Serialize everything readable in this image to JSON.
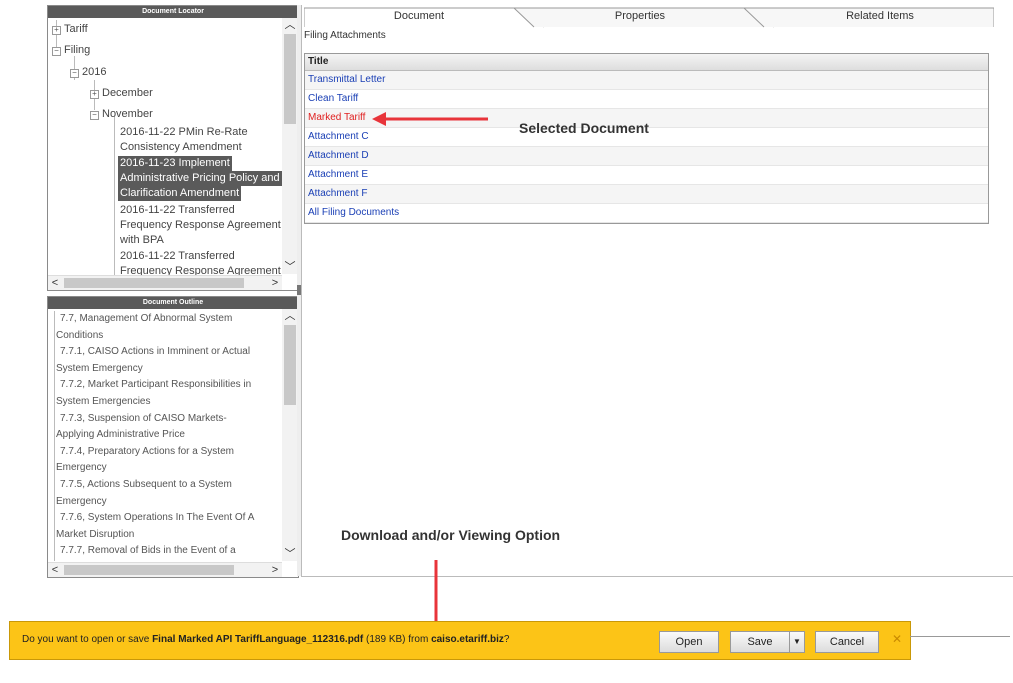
{
  "locator": {
    "header": "Document Locator",
    "items": {
      "tariff": "Tariff",
      "filing": "Filing",
      "year": "2016",
      "december": "December",
      "november": "November",
      "doc1": [
        "2016-11-22 PMin Re-Rate",
        "Consistency Amendment"
      ],
      "doc2": [
        "2016-11-23 Implement",
        "Administrative Pricing Policy and",
        "Clarification Amendment"
      ],
      "doc3": [
        "2016-11-22 Transferred",
        "Frequency Response Agreement",
        "with BPA"
      ],
      "doc4": [
        "2016-11-22 Transferred",
        "Frequency Response Agreement"
      ]
    }
  },
  "outline": {
    "header": "Document Outline",
    "items": [
      "7.7, Management Of Abnormal System",
      "Conditions",
      "7.7.1, CAISO Actions in Imminent or Actual",
      "System Emergency",
      "7.7.2, Market Participant Responsibilities in",
      "System Emergencies",
      "7.7.3, Suspension of CAISO Markets-",
      "Applying Administrative Price",
      "7.7.4, Preparatory Actions for a System",
      "Emergency",
      "7.7.5, Actions Subsequent to a System",
      "Emergency",
      "7.7.6, System Operations In The Event Of A",
      "Market Disruption",
      "7.7.7, Removal of Bids in the Event of a"
    ]
  },
  "tabs": [
    "Document",
    "Properties",
    "Related Items"
  ],
  "attachments": {
    "heading": "Filing Attachments",
    "column": "Title",
    "rows": [
      "Transmittal Letter",
      "Clean Tariff",
      "Marked Tariff",
      "Attachment C",
      "Attachment D",
      "Attachment E",
      "Attachment F",
      "All Filing Documents"
    ]
  },
  "annotations": {
    "selected": "Selected Document",
    "download": "Download and/or Viewing Option"
  },
  "download_bar": {
    "prefix": "Do you want to open or save ",
    "filename": "Final Marked API TariffLanguage_112316.pdf",
    "size": " (189 KB) from ",
    "site": "caiso.etariff.biz",
    "suffix": "?",
    "open": "Open",
    "save": "Save",
    "cancel": "Cancel"
  },
  "colors": {
    "accent_red": "#e8343a",
    "download_bar": "#fcc417",
    "link_blue": "#1a3fb5"
  }
}
